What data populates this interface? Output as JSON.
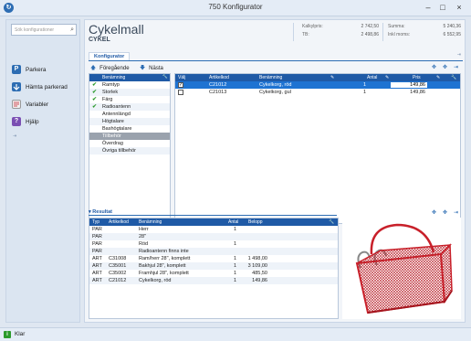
{
  "window": {
    "title": "750 Konfigurator"
  },
  "sidebar": {
    "search_placeholder": "Sök konfigurationer",
    "items": [
      {
        "label": "Parkera",
        "icon": "park-icon"
      },
      {
        "label": "Hämta parkerad",
        "icon": "retrieve-icon"
      },
      {
        "label": "Variabler",
        "icon": "variables-icon"
      },
      {
        "label": "Hjälp",
        "icon": "help-icon"
      }
    ]
  },
  "header": {
    "title": "Cykelmall",
    "subtitle": "CYKEL",
    "kalkylpris_label": "Kalkylpris:",
    "kalkylpris_value": "2 742,50",
    "tb_label": "TB:",
    "tb_value": "2 498,86",
    "summa_label": "Summa:",
    "summa_value": "5 240,36",
    "inkl_moms_label": "Inkl moms:",
    "inkl_moms_value": "6 552,95"
  },
  "tab": {
    "label": "Konfigurator"
  },
  "nav": {
    "prev": "Föregående",
    "next": "Nästa"
  },
  "tree": {
    "header": "Benämning",
    "items": [
      {
        "label": "Ramtyp",
        "done": true
      },
      {
        "label": "Storlek",
        "done": true
      },
      {
        "label": "Färg",
        "done": true
      },
      {
        "label": "Radioantenn",
        "done": true
      },
      {
        "label": "Antennlängd",
        "done": false
      },
      {
        "label": "Högtalare",
        "done": false
      },
      {
        "label": "Bashögtalare",
        "done": false
      },
      {
        "label": "Tillbehör",
        "done": false,
        "selected": true
      },
      {
        "label": "Överdrag",
        "done": false
      },
      {
        "label": "Övriga tillbehör",
        "done": false
      }
    ]
  },
  "options_grid": {
    "headers": [
      "Välj",
      "Artikelkod",
      "Benämning",
      "Antal",
      "Pris"
    ],
    "rows": [
      {
        "selected": true,
        "checked": true,
        "code": "C21012",
        "name": "Cykelkorg, röd",
        "qty": "1",
        "price": "149,86"
      },
      {
        "selected": false,
        "checked": false,
        "code": "C21013",
        "name": "Cykelkorg, gul",
        "qty": "1",
        "price": "149,86"
      }
    ]
  },
  "result": {
    "label": "Resultat",
    "headers": [
      "Typ",
      "Artikelkod",
      "Benämning",
      "Antal",
      "Belopp"
    ],
    "rows": [
      {
        "type": "PAR",
        "code": "",
        "name": "Herr",
        "qty": "1",
        "amount": ""
      },
      {
        "type": "PAR",
        "code": "",
        "name": "28\"",
        "qty": "",
        "amount": ""
      },
      {
        "type": "PAR",
        "code": "",
        "name": "Röd",
        "qty": "1",
        "amount": ""
      },
      {
        "type": "PAR",
        "code": "",
        "name": "Radioantenn finns inte",
        "qty": "",
        "amount": ""
      },
      {
        "type": "ART",
        "code": "C31008",
        "name": "Ram/herr 28\", komplett",
        "qty": "1",
        "amount": "1 498,00"
      },
      {
        "type": "ART",
        "code": "C35001",
        "name": "Bakhjul 28\", komplett",
        "qty": "1",
        "amount": "3 109,00"
      },
      {
        "type": "ART",
        "code": "C35002",
        "name": "Framhjul 28\", komplett",
        "qty": "1",
        "amount": "485,50"
      },
      {
        "type": "ART",
        "code": "C21012",
        "name": "Cykelkorg, röd",
        "qty": "1",
        "amount": "149,86"
      }
    ]
  },
  "status": {
    "text": "Klar"
  },
  "colors": {
    "accent": "#1f5aa6",
    "selection": "#1e73d2",
    "basket": "#c8202a"
  }
}
